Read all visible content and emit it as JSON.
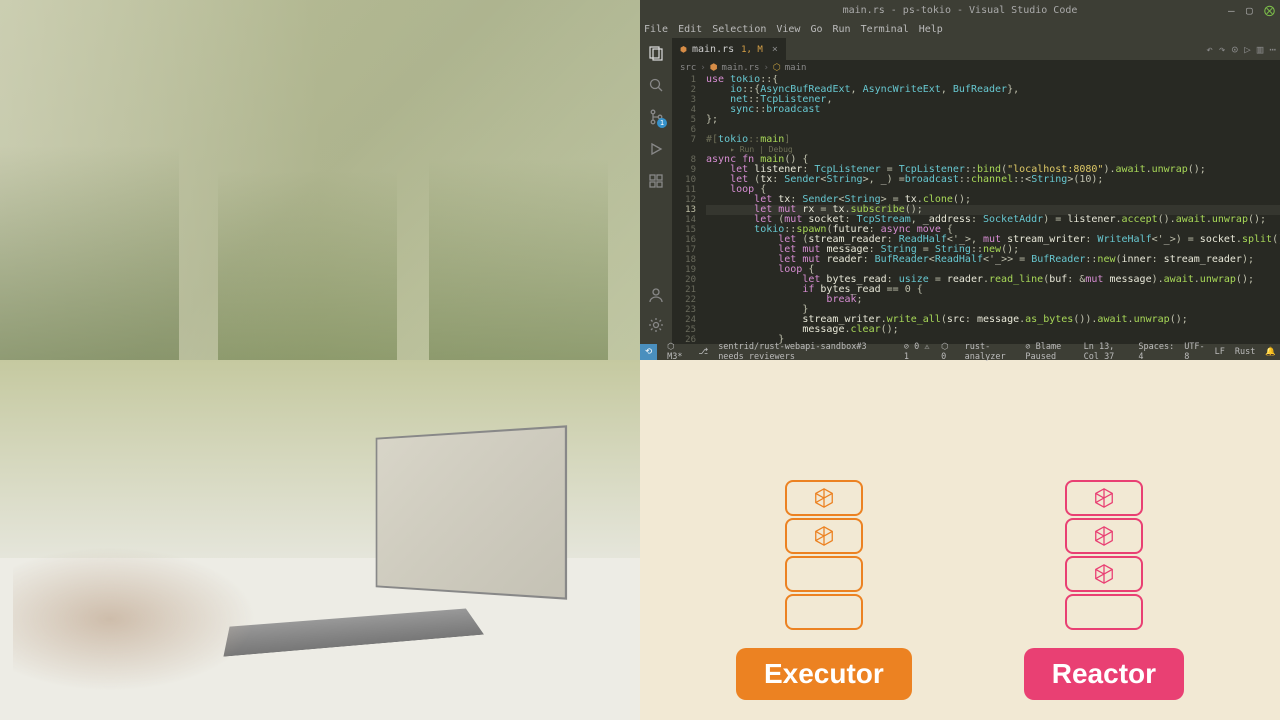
{
  "vscode": {
    "title": "main.rs - ps-tokio - Visual Studio Code",
    "menubar": [
      "File",
      "Edit",
      "Selection",
      "View",
      "Go",
      "Run",
      "Terminal",
      "Help"
    ],
    "tab": {
      "icon": "rust-file-icon",
      "name": "main.rs",
      "mod_indicator": "1, M",
      "closable": true
    },
    "breadcrumb": [
      "src",
      "main.rs",
      "main"
    ],
    "codelens": "▸ Run | Debug",
    "code_lines": [
      "use tokio::{",
      "    io::{AsyncBufReadExt, AsyncWriteExt, BufReader},",
      "    net::TcpListener,",
      "    sync::broadcast",
      "};",
      "",
      "#[tokio::main]",
      "",
      "async fn main() {",
      "    let listener: TcpListener = TcpListener::bind(\"localhost:8080\").await.unwrap();",
      "    let (tx: Sender<String>, _) =broadcast::channel::<String>(10);",
      "    loop {",
      "        let tx: Sender<String> = tx.clone();",
      "        let mut rx = tx.subscribe();",
      "        let (mut socket: TcpStream, _address: SocketAddr) = listener.accept().await.unwrap();",
      "        tokio::spawn(future: async move {",
      "            let (stream_reader: ReadHalf<'_>, mut stream_writer: WriteHalf<'_>) = socket.split();",
      "            let mut message: String = String::new();",
      "            let mut reader: BufReader<ReadHalf<'_>> = BufReader::new(inner: stream_reader);",
      "            loop {",
      "                let bytes_read: usize = reader.read_line(buf: &mut message).await.unwrap();",
      "                if bytes_read == 0 {",
      "                    break;",
      "                }",
      "                stream_writer.write_all(src: message.as_bytes()).await.unwrap();",
      "                message.clear();",
      "            }",
      "        });",
      "    }",
      "}"
    ],
    "gutter_start": 1,
    "gutter_active": 13,
    "statusbar": {
      "left": [
        "⬡ M3*",
        "⎇",
        "sentrid/rust-webapi-sandbox#3 needs reviewers",
        "⊘ 0 ⚠ 1",
        "⬡ 0",
        "rust-analyzer"
      ],
      "right": [
        "⊘ Blame Paused",
        "Ln 13, Col 37",
        "Spaces: 4",
        "UTF-8",
        "LF",
        "Rust",
        "🔔"
      ]
    }
  },
  "diagram": {
    "executor": {
      "label": "Executor",
      "color": "orange",
      "slots": [
        true,
        true,
        false,
        false
      ]
    },
    "reactor": {
      "label": "Reactor",
      "color": "pink",
      "slots": [
        true,
        true,
        true,
        false
      ]
    }
  }
}
